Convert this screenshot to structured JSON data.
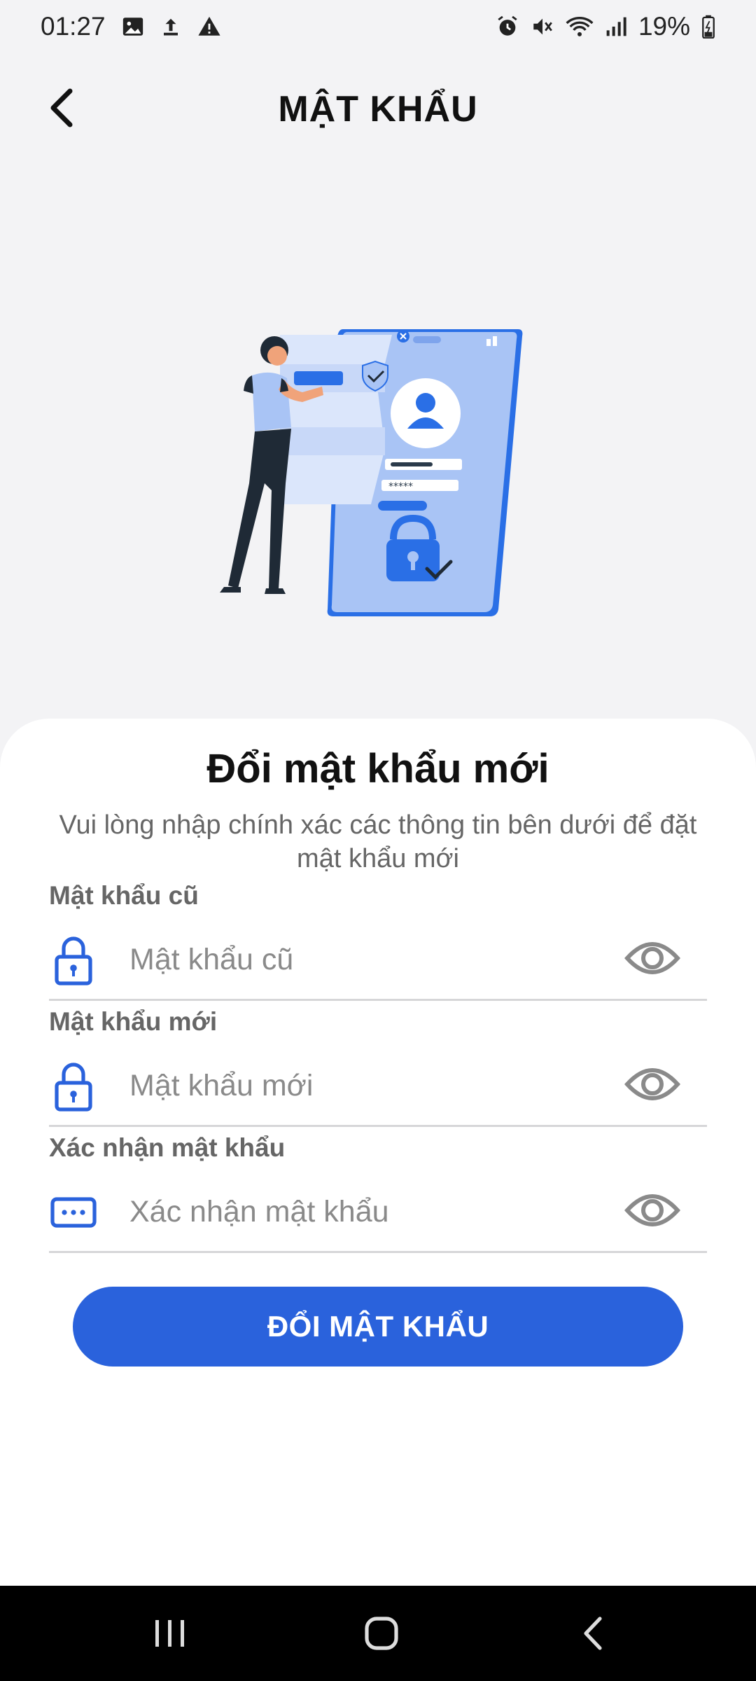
{
  "status_bar": {
    "time": "01:27",
    "battery": "19%",
    "left_icons": [
      "image-icon",
      "upload-icon",
      "warning-icon"
    ],
    "right_icons": [
      "alarm-icon",
      "mute-icon",
      "wifi-icon",
      "signal-icon",
      "battery-icon"
    ]
  },
  "header": {
    "title": "MẬT KHẨU",
    "back_icon": "chevron-left-icon"
  },
  "illustration": {
    "icon": "phone-security-illustration-icon"
  },
  "card": {
    "title": "Đổi mật khẩu mới",
    "subtitle": "Vui lòng nhập chính xác các thông tin bên dưới để đặt mật khẩu mới"
  },
  "fields": [
    {
      "label": "Mật khẩu cũ",
      "placeholder": "Mật khẩu cũ",
      "value": "",
      "icon": "lock-icon",
      "toggle_icon": "eye-icon"
    },
    {
      "label": "Mật khẩu mới",
      "placeholder": "Mật khẩu mới",
      "value": "",
      "icon": "lock-icon",
      "toggle_icon": "eye-icon"
    },
    {
      "label": "Xác nhận mật khẩu",
      "placeholder": "Xác nhận mật khẩu",
      "value": "",
      "icon": "password-dots-icon",
      "toggle_icon": "eye-icon"
    }
  ],
  "submit_button": {
    "label": "ĐỔI MẬT KHẨU"
  },
  "colors": {
    "accent": "#2a62dc",
    "icon_blue": "#2a62dc",
    "background": "#f3f3f5",
    "card": "#ffffff",
    "label_gray": "#666666",
    "divider": "#d6d6d8",
    "illustration_blue": "#a9c4f5"
  },
  "nav_bar": {
    "buttons": [
      "recent-apps-icon",
      "home-icon",
      "back-icon"
    ]
  }
}
